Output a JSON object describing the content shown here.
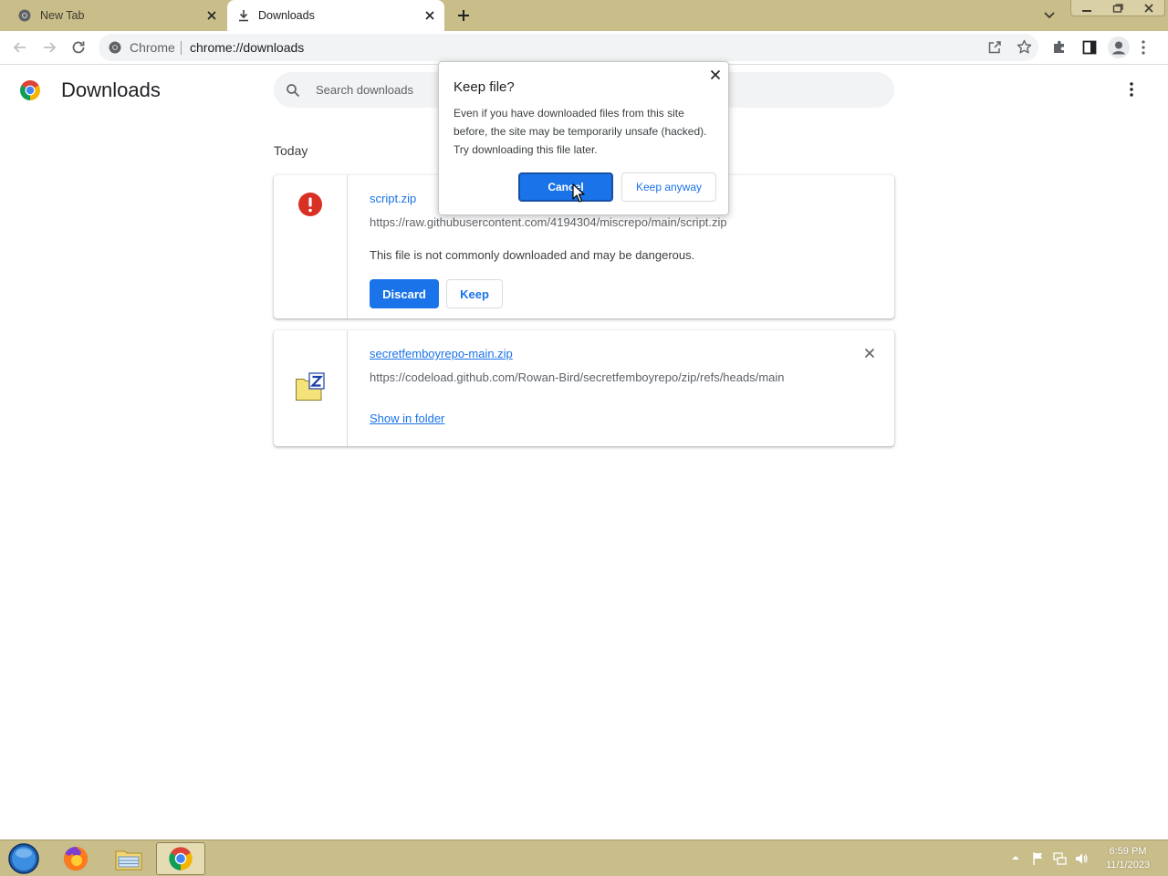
{
  "browser": {
    "tabs": [
      {
        "title": "New Tab",
        "icon": "chrome-icon",
        "active": false
      },
      {
        "title": "Downloads",
        "icon": "download-icon",
        "active": true
      }
    ],
    "omnibox": {
      "site_label": "Chrome",
      "url": "chrome://downloads"
    }
  },
  "page": {
    "title": "Downloads",
    "search_placeholder": "Search downloads",
    "section_label": "Today",
    "downloads": [
      {
        "filename": "script.zip",
        "url": "https://raw.githubusercontent.com/4194304/miscrepo/main/script.zip",
        "warning": "This file is not commonly downloaded and may be dangerous.",
        "discard_label": "Discard",
        "keep_label": "Keep",
        "status_icon": "danger-icon"
      },
      {
        "filename": "secretfemboyrepo-main.zip",
        "url": "https://codeload.github.com/Rowan-Bird/secretfemboyrepo/zip/refs/heads/main",
        "action_label": "Show in folder",
        "status_icon": "zip-file-icon"
      }
    ]
  },
  "dialog": {
    "title": "Keep file?",
    "body_lines": [
      "Even if you have downloaded files from this site",
      "before, the site may be temporarily unsafe (hacked).",
      "Try downloading this file later."
    ],
    "cancel_label": "Cancel",
    "keep_label": "Keep anyway"
  },
  "taskbar": {
    "clock_time": "6:59 PM",
    "clock_date": "11/1/2023"
  },
  "colors": {
    "accent": "#1a73e8",
    "danger": "#d93025",
    "chrome_frame": "#c9bd8a"
  }
}
